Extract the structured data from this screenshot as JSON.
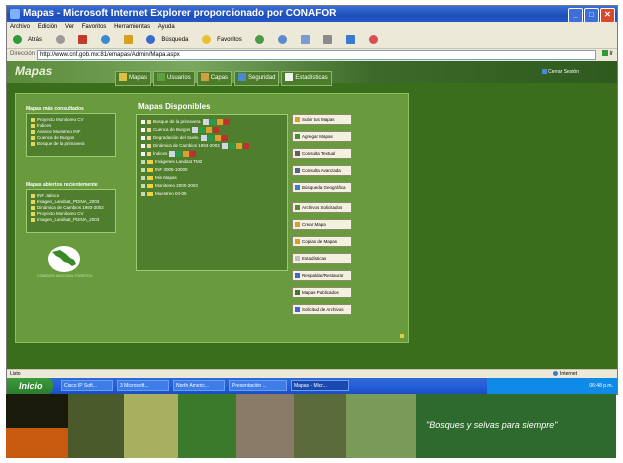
{
  "window": {
    "title": "Mapas - Microsoft Internet Explorer proporcionado por CONAFOR"
  },
  "menubar": {
    "items": [
      "Archivo",
      "Edición",
      "Ver",
      "Favoritos",
      "Herramientas",
      "Ayuda"
    ]
  },
  "toolbar": {
    "back_label": "Atrás",
    "search_label": "Búsqueda",
    "favorites_label": "Favoritos"
  },
  "addressbar": {
    "label": "Dirección",
    "value": "http://www.cnf.gob.mx:81/emapas/Admin/Mapa.aspx",
    "go_label": "Ir"
  },
  "header": {
    "logo_text": "Mapas",
    "tabs": [
      {
        "label": "Mapas",
        "icon": "map-icon"
      },
      {
        "label": "Usuarios",
        "icon": "users-icon"
      },
      {
        "label": "Capas",
        "icon": "layers-icon"
      },
      {
        "label": "Seguridad",
        "icon": "lock-icon"
      },
      {
        "label": "Estadísticas",
        "icon": "stats-icon"
      }
    ],
    "close_session": "Cerrar Sesión"
  },
  "most_viewed": {
    "title": "Mapas más consultados",
    "items": [
      "Proyecto Monitoreo CV",
      "Índices",
      "Avance Muestreo INF",
      "Cuenca de Burgos",
      "Bosque de la primavera"
    ]
  },
  "recent": {
    "title": "Mapas abiertos recientemente",
    "items": [
      "INF Jalisco",
      "Imagen_Landsat_PDINA_2003",
      "Dinámica de Cambios 1993-2002",
      "Proyecto Monitoreo CV",
      "Imagen_Landsat_PDINA_2003"
    ]
  },
  "available": {
    "title": "Mapas Disponibles",
    "items": [
      {
        "label": "Bosque de la primavera",
        "type": "map",
        "actions": true
      },
      {
        "label": "Cuenca de Burgos",
        "type": "map",
        "actions": true
      },
      {
        "label": "Degradación del Suelo",
        "type": "map",
        "actions": true
      },
      {
        "label": "Dinámica de Cambios 1993-2002",
        "type": "map",
        "actions": true
      },
      {
        "label": "Índices",
        "type": "map",
        "actions": true
      },
      {
        "label": "Imágenes Landsat TM2",
        "type": "folder",
        "actions": false
      },
      {
        "label": "INF 2005-10000",
        "type": "folder",
        "actions": false
      },
      {
        "label": "Mis Mapas",
        "type": "folder",
        "actions": false
      },
      {
        "label": "Monitoreo 2000-2003",
        "type": "folder",
        "actions": false
      },
      {
        "label": "Muestreo 04-05",
        "type": "folder",
        "actions": false
      }
    ]
  },
  "side_buttons": [
    "Subir tus Mapas",
    "Agregar Mapas",
    "Consulta Textual",
    "Consulta Avanzada",
    "Búsqueda Geográfica",
    "Archivos Solicitados",
    "Crear Mapa",
    "Copias de Mapas",
    "Estadísticas",
    "Respaldar/Restaurar",
    "Mapas Publicados",
    "Solicitud de Archivos"
  ],
  "conafor": {
    "caption": "COMISIÓN NACIONAL FORESTAL"
  },
  "statusbar": {
    "left": "Listo",
    "zone": "Internet"
  },
  "taskbar": {
    "start_label": "Inicio",
    "tasks": [
      "Cisco IP Soft...",
      "3 Microsoft...",
      "North Americ...",
      "Presentación ...",
      "Mapas - Micr..."
    ],
    "clock": "06:48 p.m."
  },
  "banner": {
    "slogan": "\"Bosques y selvas para siempre\""
  }
}
